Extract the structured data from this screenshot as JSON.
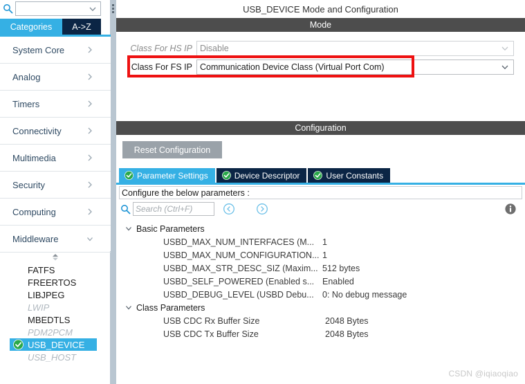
{
  "sidebar": {
    "search": {
      "value": "",
      "placeholder": "",
      "icon": "search-icon",
      "arrow_icon": "chevron-down-icon"
    },
    "tabs": [
      {
        "label": "Categories",
        "active": true
      },
      {
        "label": "A->Z",
        "active": false
      }
    ],
    "categories": [
      {
        "label": "System Core",
        "chevron": "chevron-right-icon"
      },
      {
        "label": "Analog",
        "chevron": "chevron-right-icon"
      },
      {
        "label": "Timers",
        "chevron": "chevron-right-icon"
      },
      {
        "label": "Connectivity",
        "chevron": "chevron-right-icon"
      },
      {
        "label": "Multimedia",
        "chevron": "chevron-right-icon"
      },
      {
        "label": "Security",
        "chevron": "chevron-right-icon"
      },
      {
        "label": "Computing",
        "chevron": "chevron-right-icon"
      },
      {
        "label": "Middleware",
        "chevron": "chevron-down-icon"
      }
    ],
    "middleware_items": [
      {
        "label": "FATFS",
        "state": "normal"
      },
      {
        "label": "FREERTOS",
        "state": "normal"
      },
      {
        "label": "LIBJPEG",
        "state": "normal"
      },
      {
        "label": "LWIP",
        "state": "disabled"
      },
      {
        "label": "MBEDTLS",
        "state": "normal"
      },
      {
        "label": "PDM2PCM",
        "state": "disabled"
      },
      {
        "label": "USB_DEVICE",
        "state": "selected",
        "check_icon": "green-check-icon"
      },
      {
        "label": "USB_HOST",
        "state": "disabled"
      }
    ]
  },
  "pane": {
    "title": "USB_DEVICE Mode and Configuration",
    "mode": {
      "header": "Mode",
      "rows": [
        {
          "label": "Class For HS IP",
          "value": "Disable",
          "enabled": false,
          "arrow_icon": "chevron-down-icon"
        },
        {
          "label": "Class For FS IP",
          "value": "Communication Device Class (Virtual Port Com)",
          "enabled": true,
          "highlighted": true,
          "arrow_icon": "chevron-down-icon"
        }
      ]
    },
    "configuration": {
      "header": "Configuration",
      "reset_label": "Reset Configuration",
      "tabs": [
        {
          "label": "Parameter Settings",
          "active": true,
          "check_icon": "green-check-icon"
        },
        {
          "label": "Device Descriptor",
          "active": false,
          "check_icon": "green-check-icon"
        },
        {
          "label": "User Constants",
          "active": false,
          "check_icon": "green-check-icon"
        }
      ],
      "note": "Configure the below parameters :",
      "toolbar": {
        "search_value": "",
        "search_placeholder": "Search (Ctrl+F)",
        "search_icon": "search-icon",
        "prev_icon": "circle-left-arrow-icon",
        "next_icon": "circle-right-arrow-icon",
        "info_icon": "info-icon"
      },
      "groups": [
        {
          "label": "Basic Parameters",
          "expanded": true,
          "caret_icon": "chevron-down-icon",
          "rows": [
            {
              "name": "USBD_MAX_NUM_INTERFACES (M...",
              "value": "1"
            },
            {
              "name": "USBD_MAX_NUM_CONFIGURATION...",
              "value": "1"
            },
            {
              "name": "USBD_MAX_STR_DESC_SIZ (Maxim...",
              "value": "512 bytes"
            },
            {
              "name": "USBD_SELF_POWERED (Enabled s...",
              "value": "Enabled"
            },
            {
              "name": "USBD_DEBUG_LEVEL (USBD Debu...",
              "value": "0: No debug message"
            }
          ]
        },
        {
          "label": "Class Parameters",
          "expanded": true,
          "caret_icon": "chevron-down-icon",
          "rows": [
            {
              "name": "USB CDC Rx Buffer Size",
              "value": "2048 Bytes"
            },
            {
              "name": "USB CDC Tx Buffer Size",
              "value": "2048 Bytes"
            }
          ]
        }
      ]
    }
  },
  "watermark": "CSDN @iqiaoqiao",
  "colors": {
    "accent_blue": "#35b0e4",
    "dark_navy": "#0b2545",
    "header_grey": "#4d4d4d",
    "highlight_red": "#ee1111",
    "check_green": "#2aa84a"
  }
}
